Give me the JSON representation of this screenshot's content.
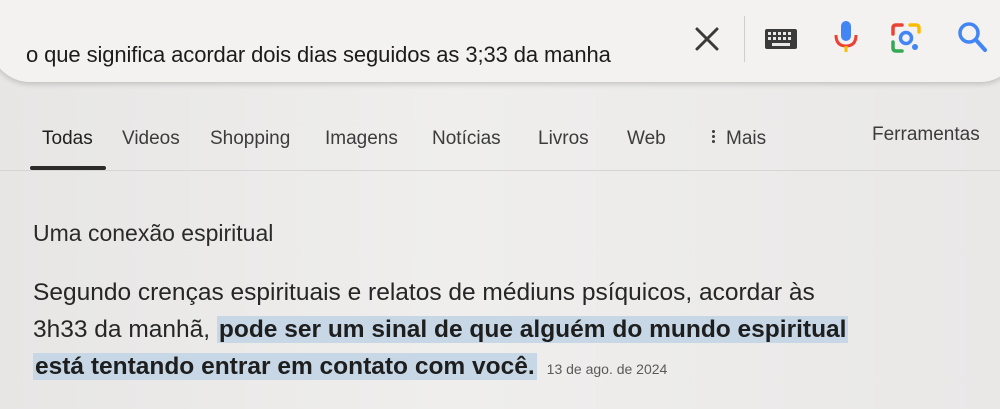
{
  "search": {
    "query": "o que significa acordar dois dias seguidos as 3;33 da manha"
  },
  "icons": {
    "clear": "close-icon",
    "keyboard": "keyboard-icon",
    "mic": "microphone-icon",
    "lens": "lens-icon",
    "search": "search-icon"
  },
  "tabs": [
    {
      "label": "Todas",
      "active": true
    },
    {
      "label": "Videos"
    },
    {
      "label": "Shopping"
    },
    {
      "label": "Imagens"
    },
    {
      "label": "Notícias"
    },
    {
      "label": "Livros"
    },
    {
      "label": "Web"
    },
    {
      "label": "Mais"
    },
    {
      "label": "Ferramentas"
    }
  ],
  "result": {
    "heading": "Uma conexão espiritual",
    "line1": "Segundo crenças espirituais e relatos de médiuns psíquicos, acordar às",
    "line2_plain": "3h33 da manhã, ",
    "line2_highlight": "pode ser um sinal de que alguém do mundo espiritual",
    "line3_highlight": "está tentando entrar em contato com você.",
    "date": "13 de ago. de 2024"
  },
  "colors": {
    "highlight": "#c7d7e5",
    "google_blue": "#4285f4",
    "google_red": "#ea4335",
    "google_yellow": "#fbbc05",
    "google_green": "#34a853"
  }
}
